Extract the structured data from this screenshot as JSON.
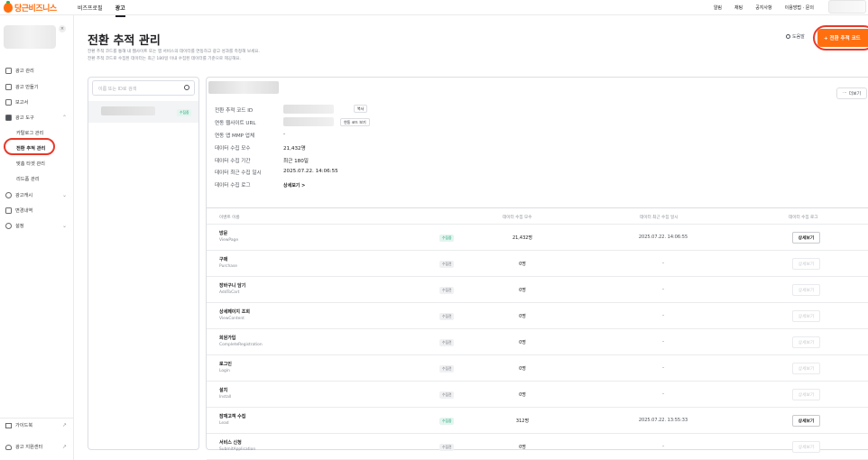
{
  "brand": {
    "logo_text": "당근비즈니스",
    "accent": "#ff6f0f"
  },
  "topnav": {
    "items": [
      "비즈프로필",
      "광고"
    ],
    "active": "광고"
  },
  "topright": {
    "items": [
      "알림",
      "채팅",
      "공지사항",
      "이용방법 · 문의"
    ]
  },
  "sidebar": {
    "items": [
      {
        "label": "광고 관리",
        "icon": "megaphone-icon"
      },
      {
        "label": "광고 만들기",
        "icon": "plus-square-icon"
      },
      {
        "label": "보고서",
        "icon": "report-icon"
      },
      {
        "label": "광고 도구",
        "icon": "toolbox-icon"
      }
    ],
    "tools_sub": [
      "카탈로그 관리",
      "전환 추적 관리",
      "맞춤 타겟 관리",
      "리드폼 관리"
    ],
    "more_items": [
      {
        "label": "광고캐시",
        "icon": "cash-icon"
      },
      {
        "label": "변경내역",
        "icon": "history-icon"
      },
      {
        "label": "설정",
        "icon": "gear-icon"
      }
    ],
    "bottom_items": [
      {
        "label": "가이드북",
        "icon": "book-icon"
      },
      {
        "label": "광고 지원센터",
        "icon": "headset-icon"
      }
    ]
  },
  "page": {
    "title": "전환 추적 관리",
    "desc_line1": "전환 추적 코드를 통해 내 웹사이트 또는 앱 서비스의 데이터를 연동하고 광고 성과를 측정해 보세요.",
    "desc_line2": "전환 추적 코드로 수집된 데이터는 최근 180일 이내 수집된 데이터를 기준으로 제공해요.",
    "help_label": "도움말",
    "add_label": "+ 전환 추적 코드"
  },
  "list": {
    "search_placeholder": "이름 또는 ID로 검색",
    "item_badge": "수집중"
  },
  "detail": {
    "more_label": "더보기",
    "rows": [
      {
        "label": "전환 추적 코드 ID",
        "value": ""
      },
      {
        "label": "연동 웹사이트 URL",
        "value": ""
      },
      {
        "label": "연동 앱 MMP 업체",
        "value": "-"
      },
      {
        "label": "데이터 수집 모수",
        "value": "21,432명"
      },
      {
        "label": "데이터 수집 기간",
        "value": "최근 180일"
      },
      {
        "label": "데이터 최근 수집 일시",
        "value": "2025.07.22. 14:06:55"
      },
      {
        "label": "데이터 수집 로그",
        "value": "상세보기 >"
      }
    ],
    "copy_label": "복사",
    "code_view_label": "연동 코드 보기"
  },
  "table": {
    "headers": [
      "이벤트 이름",
      "데이터 수집 모수",
      "데이터 최근 수집 일시",
      "데이터 수집 로그"
    ],
    "rows": [
      {
        "name": "방문",
        "en": "ViewPage",
        "status": "수집중",
        "count": "21,432명",
        "last": "2025.07.22. 14:06:55",
        "log": "상세보기",
        "active": true
      },
      {
        "name": "구매",
        "en": "Purchase",
        "status": "수집전",
        "count": "0명",
        "last": "-",
        "log": "상세보기",
        "active": false
      },
      {
        "name": "장바구니 담기",
        "en": "AddToCart",
        "status": "수집전",
        "count": "0명",
        "last": "-",
        "log": "상세보기",
        "active": false
      },
      {
        "name": "상세페이지 조회",
        "en": "ViewContent",
        "status": "수집전",
        "count": "0명",
        "last": "-",
        "log": "상세보기",
        "active": false
      },
      {
        "name": "회원가입",
        "en": "CompleteRegistration",
        "status": "수집전",
        "count": "0명",
        "last": "-",
        "log": "상세보기",
        "active": false
      },
      {
        "name": "로그인",
        "en": "Login",
        "status": "수집전",
        "count": "0명",
        "last": "-",
        "log": "상세보기",
        "active": false
      },
      {
        "name": "설치",
        "en": "Install",
        "status": "수집전",
        "count": "0명",
        "last": "-",
        "log": "상세보기",
        "active": false
      },
      {
        "name": "잠재고객 수집",
        "en": "Lead",
        "status": "수집중",
        "count": "312명",
        "last": "2025.07.22. 13:55:33",
        "log": "상세보기",
        "active": true
      },
      {
        "name": "서비스 신청",
        "en": "SubmitApplication",
        "status": "수집전",
        "count": "0명",
        "last": "-",
        "log": "상세보기",
        "active": false
      }
    ]
  }
}
